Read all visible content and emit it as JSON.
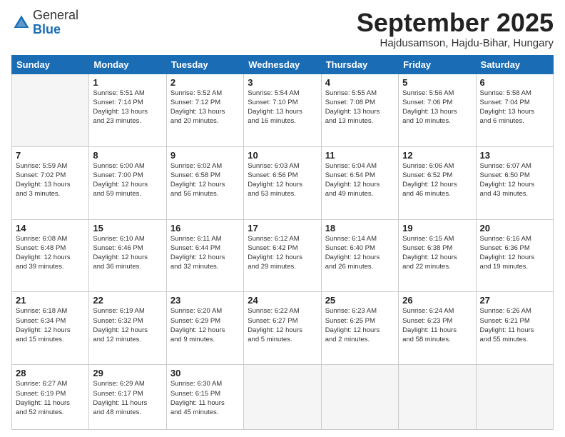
{
  "logo": {
    "general": "General",
    "blue": "Blue"
  },
  "title": "September 2025",
  "location": "Hajdusamson, Hajdu-Bihar, Hungary",
  "weekdays": [
    "Sunday",
    "Monday",
    "Tuesday",
    "Wednesday",
    "Thursday",
    "Friday",
    "Saturday"
  ],
  "weeks": [
    [
      {
        "day": "",
        "info": ""
      },
      {
        "day": "1",
        "info": "Sunrise: 5:51 AM\nSunset: 7:14 PM\nDaylight: 13 hours\nand 23 minutes."
      },
      {
        "day": "2",
        "info": "Sunrise: 5:52 AM\nSunset: 7:12 PM\nDaylight: 13 hours\nand 20 minutes."
      },
      {
        "day": "3",
        "info": "Sunrise: 5:54 AM\nSunset: 7:10 PM\nDaylight: 13 hours\nand 16 minutes."
      },
      {
        "day": "4",
        "info": "Sunrise: 5:55 AM\nSunset: 7:08 PM\nDaylight: 13 hours\nand 13 minutes."
      },
      {
        "day": "5",
        "info": "Sunrise: 5:56 AM\nSunset: 7:06 PM\nDaylight: 13 hours\nand 10 minutes."
      },
      {
        "day": "6",
        "info": "Sunrise: 5:58 AM\nSunset: 7:04 PM\nDaylight: 13 hours\nand 6 minutes."
      }
    ],
    [
      {
        "day": "7",
        "info": "Sunrise: 5:59 AM\nSunset: 7:02 PM\nDaylight: 13 hours\nand 3 minutes."
      },
      {
        "day": "8",
        "info": "Sunrise: 6:00 AM\nSunset: 7:00 PM\nDaylight: 12 hours\nand 59 minutes."
      },
      {
        "day": "9",
        "info": "Sunrise: 6:02 AM\nSunset: 6:58 PM\nDaylight: 12 hours\nand 56 minutes."
      },
      {
        "day": "10",
        "info": "Sunrise: 6:03 AM\nSunset: 6:56 PM\nDaylight: 12 hours\nand 53 minutes."
      },
      {
        "day": "11",
        "info": "Sunrise: 6:04 AM\nSunset: 6:54 PM\nDaylight: 12 hours\nand 49 minutes."
      },
      {
        "day": "12",
        "info": "Sunrise: 6:06 AM\nSunset: 6:52 PM\nDaylight: 12 hours\nand 46 minutes."
      },
      {
        "day": "13",
        "info": "Sunrise: 6:07 AM\nSunset: 6:50 PM\nDaylight: 12 hours\nand 43 minutes."
      }
    ],
    [
      {
        "day": "14",
        "info": "Sunrise: 6:08 AM\nSunset: 6:48 PM\nDaylight: 12 hours\nand 39 minutes."
      },
      {
        "day": "15",
        "info": "Sunrise: 6:10 AM\nSunset: 6:46 PM\nDaylight: 12 hours\nand 36 minutes."
      },
      {
        "day": "16",
        "info": "Sunrise: 6:11 AM\nSunset: 6:44 PM\nDaylight: 12 hours\nand 32 minutes."
      },
      {
        "day": "17",
        "info": "Sunrise: 6:12 AM\nSunset: 6:42 PM\nDaylight: 12 hours\nand 29 minutes."
      },
      {
        "day": "18",
        "info": "Sunrise: 6:14 AM\nSunset: 6:40 PM\nDaylight: 12 hours\nand 26 minutes."
      },
      {
        "day": "19",
        "info": "Sunrise: 6:15 AM\nSunset: 6:38 PM\nDaylight: 12 hours\nand 22 minutes."
      },
      {
        "day": "20",
        "info": "Sunrise: 6:16 AM\nSunset: 6:36 PM\nDaylight: 12 hours\nand 19 minutes."
      }
    ],
    [
      {
        "day": "21",
        "info": "Sunrise: 6:18 AM\nSunset: 6:34 PM\nDaylight: 12 hours\nand 15 minutes."
      },
      {
        "day": "22",
        "info": "Sunrise: 6:19 AM\nSunset: 6:32 PM\nDaylight: 12 hours\nand 12 minutes."
      },
      {
        "day": "23",
        "info": "Sunrise: 6:20 AM\nSunset: 6:29 PM\nDaylight: 12 hours\nand 9 minutes."
      },
      {
        "day": "24",
        "info": "Sunrise: 6:22 AM\nSunset: 6:27 PM\nDaylight: 12 hours\nand 5 minutes."
      },
      {
        "day": "25",
        "info": "Sunrise: 6:23 AM\nSunset: 6:25 PM\nDaylight: 12 hours\nand 2 minutes."
      },
      {
        "day": "26",
        "info": "Sunrise: 6:24 AM\nSunset: 6:23 PM\nDaylight: 11 hours\nand 58 minutes."
      },
      {
        "day": "27",
        "info": "Sunrise: 6:26 AM\nSunset: 6:21 PM\nDaylight: 11 hours\nand 55 minutes."
      }
    ],
    [
      {
        "day": "28",
        "info": "Sunrise: 6:27 AM\nSunset: 6:19 PM\nDaylight: 11 hours\nand 52 minutes."
      },
      {
        "day": "29",
        "info": "Sunrise: 6:29 AM\nSunset: 6:17 PM\nDaylight: 11 hours\nand 48 minutes."
      },
      {
        "day": "30",
        "info": "Sunrise: 6:30 AM\nSunset: 6:15 PM\nDaylight: 11 hours\nand 45 minutes."
      },
      {
        "day": "",
        "info": ""
      },
      {
        "day": "",
        "info": ""
      },
      {
        "day": "",
        "info": ""
      },
      {
        "day": "",
        "info": ""
      }
    ]
  ]
}
